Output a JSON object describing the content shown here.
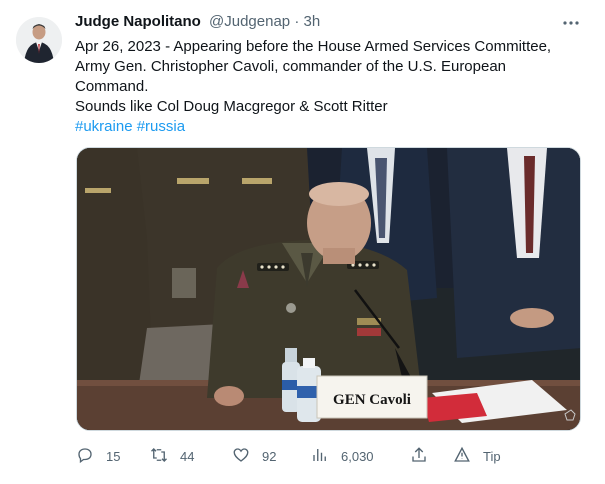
{
  "author": {
    "name": "Judge Napolitano",
    "handle": "@Judgenap",
    "separator": "·",
    "time": "3h"
  },
  "tweet": {
    "line1": "Apr 26, 2023 - Appearing before the House Armed Services Committee,",
    "line2": "Army Gen. Christopher Cavoli, commander of the U.S. European",
    "line3": "Command.",
    "line4": "Sounds like Col Doug Macgregor & Scott Ritter",
    "hashtag1": "#ukraine",
    "hashtag2": "#russia"
  },
  "media": {
    "nameplate": "GEN Cavoli"
  },
  "actions": {
    "replies": "15",
    "retweets": "44",
    "likes": "92",
    "views": "6,030",
    "tip": "Tip"
  },
  "icons": {
    "more": "more-icon",
    "reply": "reply-icon",
    "retweet": "retweet-icon",
    "like": "heart-icon",
    "views": "views-icon",
    "share": "share-icon",
    "tip": "tip-icon"
  },
  "colors": {
    "link": "#1d9bf0",
    "secondary_text": "#536471",
    "primary_text": "#0f1419"
  }
}
